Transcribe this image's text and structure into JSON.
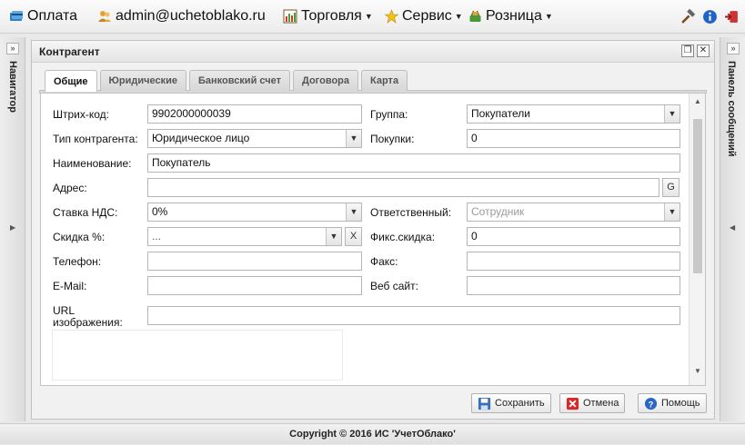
{
  "topbar": {
    "items": [
      {
        "label": "Оплата",
        "icon": "payment-icon",
        "has_caret": false
      },
      {
        "label": "admin@uchetoblako.ru",
        "icon": "users-icon",
        "has_caret": false
      },
      {
        "label": "Торговля",
        "icon": "chart-icon",
        "has_caret": true
      },
      {
        "label": "Сервис",
        "icon": "star-icon",
        "has_caret": true
      },
      {
        "label": "Розница",
        "icon": "cart-icon",
        "has_caret": true
      }
    ],
    "right_icons": [
      "hammer-icon",
      "info-icon",
      "logout-icon"
    ]
  },
  "navigator": {
    "title": "Навигатор"
  },
  "messages_panel": {
    "title": "Панель сообщений"
  },
  "window": {
    "title": "Контрагент",
    "tabs": [
      {
        "label": "Общие",
        "active": true
      },
      {
        "label": "Юридические",
        "active": false
      },
      {
        "label": "Банковский счет",
        "active": false
      },
      {
        "label": "Договора",
        "active": false
      },
      {
        "label": "Карта",
        "active": false
      }
    ]
  },
  "form": {
    "barcode": {
      "label": "Штрих-код:",
      "value": "9902000000039"
    },
    "group": {
      "label": "Группа:",
      "value": "Покупатели"
    },
    "type": {
      "label": "Тип контрагента:",
      "value": "Юридическое лицо"
    },
    "purchases": {
      "label": "Покупки:",
      "value": "0"
    },
    "name": {
      "label": "Наименование:",
      "value": "Покупатель"
    },
    "address": {
      "label": "Адрес:",
      "value": "",
      "button": "G"
    },
    "vat": {
      "label": "Ставка НДС:",
      "value": "0%"
    },
    "responsible": {
      "label": "Ответственный:",
      "placeholder": "Сотрудник"
    },
    "discount": {
      "label": "Скидка %:",
      "value": "...",
      "clear_button": "X"
    },
    "fixed_discount": {
      "label": "Фикс.скидка:",
      "value": "0"
    },
    "phone": {
      "label": "Телефон:",
      "value": ""
    },
    "fax": {
      "label": "Факс:",
      "value": ""
    },
    "email": {
      "label": "E-Mail:",
      "value": ""
    },
    "website": {
      "label": "Веб сайт:",
      "value": ""
    },
    "image_url": {
      "label_line1": "URL",
      "label_line2": "изображения:",
      "value": ""
    }
  },
  "buttons": {
    "save": "Сохранить",
    "cancel": "Отмена",
    "help": "Помощь"
  },
  "footer": {
    "copyright": "Copyright © 2016 ИС 'УчетОблако'"
  }
}
